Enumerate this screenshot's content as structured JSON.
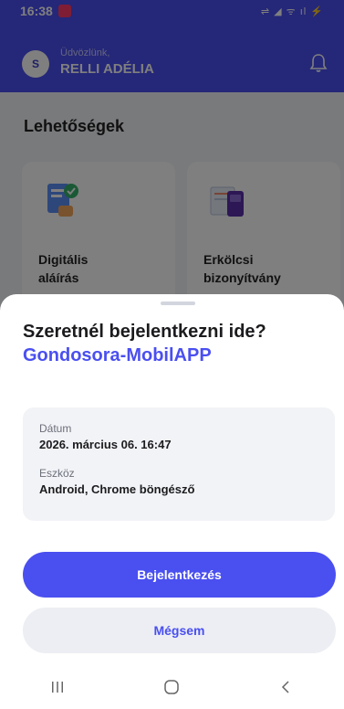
{
  "statusbar": {
    "time": "16:38",
    "indicators": "⇌ ◢ ᯤ ıl ⚡"
  },
  "header": {
    "avatar_initial": "S",
    "greeting": "Üdvözlünk,",
    "user_name": "RELLI ADÉLIA",
    "bell_icon": "bell-icon"
  },
  "options": {
    "title": "Lehetőségek",
    "cards": [
      {
        "label": "Digitális\naláírás",
        "icon": "digital-signature-illustration"
      },
      {
        "label": "Erkölcsi\nbizonyítvány",
        "icon": "certificate-illustration"
      }
    ]
  },
  "sheet": {
    "question": "Szeretnél bejelentkezni ide?",
    "app_name": "Gondosora-MobilAPP",
    "date_label": "Dátum",
    "date_value": "2026. március 06. 16:47",
    "device_label": "Eszköz",
    "device_value": "Android, Chrome böngésző",
    "login_button": "Bejelentkezés",
    "cancel_button": "Mégsem"
  },
  "colors": {
    "primary": "#4a4ff0",
    "surface": "#f2f3f6",
    "secondary_button": "#eceef3"
  },
  "navbar": {
    "icons": [
      "recents-icon",
      "home-icon",
      "back-icon"
    ]
  }
}
